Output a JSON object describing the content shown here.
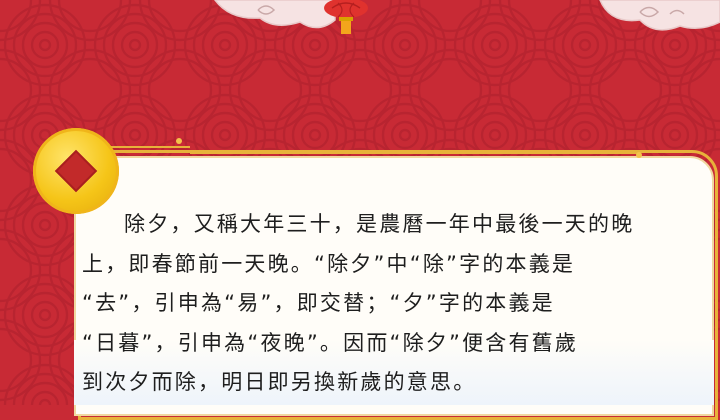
{
  "colors": {
    "background": "#c82a35",
    "card": "#fffdf8",
    "gold": "#e8b23a",
    "coin": "#f5c518",
    "coin_center": "#c22a2a",
    "text": "#1e1e1e",
    "lantern": "#e0322e"
  },
  "icons": {
    "coin": "chinese-coin-icon",
    "lantern": "lantern-icon",
    "clouds": "auspicious-cloud-icon"
  },
  "paragraph": {
    "line1": "除夕，又稱大年三十，是農曆一年中最後一天的晚",
    "line2": "上，即春節前一天晚。“除夕”中“除”字的本義是",
    "line3": "“去”，引申為“易”，即交替；“夕”字的本義是",
    "line4": "“日暮”，引申為“夜晚”。因而“除夕”便含有舊歲",
    "line5": "到次夕而除，明日即另換新歲的意思。"
  }
}
